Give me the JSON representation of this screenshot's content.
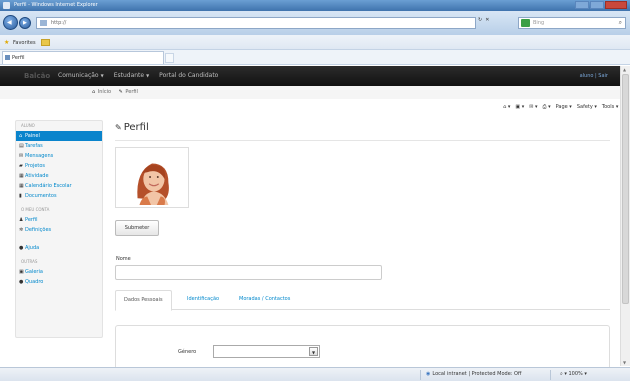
{
  "browser": {
    "window_title": "Perfil - Windows Internet Explorer",
    "address": "http://",
    "search_placeholder": "Bing",
    "favorites_label": "Favorites",
    "tab_title": "Perfil",
    "cmd_page": "Page ▾",
    "cmd_safety": "Safety ▾",
    "cmd_tools": "Tools ▾",
    "cmd_help": "?",
    "status_zone": "Local intranet | Protected Mode: Off",
    "status_zoom": "100%"
  },
  "navbar": {
    "brand": "Balcão",
    "menu": [
      {
        "label": "Comunicação",
        "dropdown": true
      },
      {
        "label": "Estudante",
        "dropdown": true
      },
      {
        "label": "Portal do Candidato",
        "dropdown": false
      }
    ],
    "user": "aluno | Sair"
  },
  "breadcrumb": {
    "home": "Início",
    "current": "Perfil"
  },
  "sidebar": {
    "section1": "Aluno",
    "items1": [
      {
        "label": "Painel",
        "icon": "home-icon",
        "glyph": "⌂",
        "active": true
      },
      {
        "label": "Tarefas",
        "icon": "tasks-icon",
        "glyph": "▤",
        "active": false
      },
      {
        "label": "Mensagens",
        "icon": "messages-icon",
        "glyph": "✉",
        "active": false
      },
      {
        "label": "Projetos",
        "icon": "folder-icon",
        "glyph": "▰",
        "active": false
      },
      {
        "label": "Atividade",
        "icon": "activity-icon",
        "glyph": "▦",
        "active": false
      },
      {
        "label": "Calendário Escolar",
        "icon": "calendar-icon",
        "glyph": "▦",
        "active": false
      },
      {
        "label": "Documentos",
        "icon": "document-icon",
        "glyph": "▮",
        "active": false
      }
    ],
    "section2": "O meu conta",
    "items2": [
      {
        "label": "Perfil",
        "icon": "user-icon",
        "glyph": "♟"
      },
      {
        "label": "Definições",
        "icon": "gear-icon",
        "glyph": "✲"
      }
    ],
    "help_item": {
      "label": "Ajuda",
      "icon": "help-icon",
      "glyph": "●"
    },
    "section3": "Outras",
    "items3": [
      {
        "label": "Galeria",
        "icon": "gallery-icon",
        "glyph": "▣"
      },
      {
        "label": "Quadro",
        "icon": "board-icon",
        "glyph": "●"
      }
    ]
  },
  "main": {
    "title": "Perfil",
    "submit_label": "Submeter",
    "name_label": "Nome",
    "name_value": "",
    "tabs": [
      {
        "label": "Dados Pessoais",
        "active": true
      },
      {
        "label": "Identificação",
        "active": false
      },
      {
        "label": "Moradas / Contactos",
        "active": false
      }
    ],
    "gender_label": "Género",
    "gender_value": ""
  }
}
